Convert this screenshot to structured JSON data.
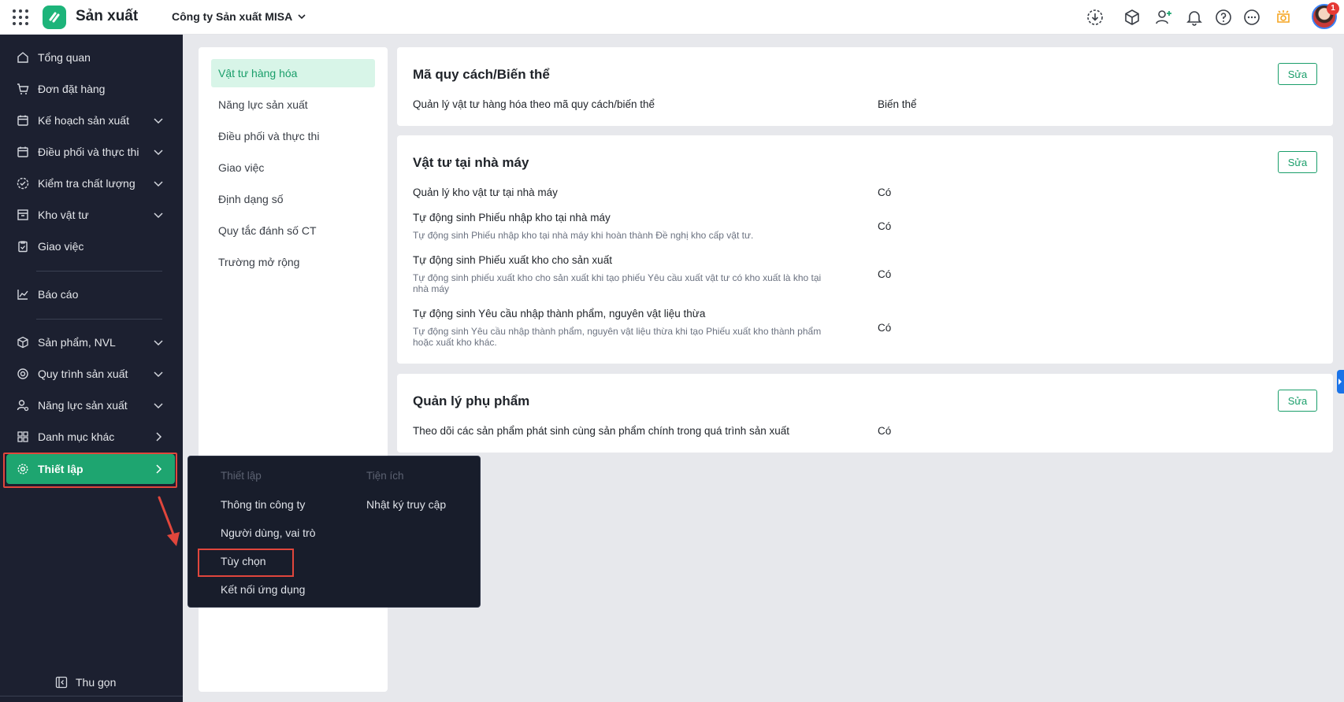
{
  "header": {
    "app_name": "Sản xuất",
    "company": "Công ty Sản xuất MISA",
    "notification_count": "1"
  },
  "sidebar": {
    "items": [
      {
        "label": "Tổng quan"
      },
      {
        "label": "Đơn đặt hàng"
      },
      {
        "label": "Kế hoạch sản xuất"
      },
      {
        "label": "Điều phối và thực thi"
      },
      {
        "label": "Kiểm tra chất lượng"
      },
      {
        "label": "Kho vật tư"
      },
      {
        "label": "Giao việc"
      },
      {
        "label": "Báo cáo"
      },
      {
        "label": "Sản phẩm, NVL"
      },
      {
        "label": "Quy trình sản xuất"
      },
      {
        "label": "Năng lực sản xuất"
      },
      {
        "label": "Danh mục khác"
      },
      {
        "label": "Thiết lập"
      }
    ],
    "collapse_label": "Thu gọn"
  },
  "settings_menu": {
    "items": [
      {
        "label": "Vật tư hàng hóa"
      },
      {
        "label": "Năng lực sản xuất"
      },
      {
        "label": "Điều phối và thực thi"
      },
      {
        "label": "Giao việc"
      },
      {
        "label": "Định dạng số"
      },
      {
        "label": "Quy tắc đánh số CT"
      },
      {
        "label": "Trường mở rộng"
      }
    ]
  },
  "cards": {
    "variant": {
      "title": "Mã quy cách/Biến thể",
      "edit_label": "Sửa",
      "rows": [
        {
          "label": "Quản lý vật tư hàng hóa theo mã quy cách/biến thể",
          "value": "Biến thể"
        }
      ]
    },
    "factory": {
      "title": "Vật tư tại nhà máy",
      "edit_label": "Sửa",
      "rows": [
        {
          "label": "Quản lý kho vật tư tại nhà máy",
          "desc": "",
          "value": "Có"
        },
        {
          "label": "Tự động sinh Phiếu nhập kho tại nhà máy",
          "desc": "Tự động sinh Phiếu nhập kho tại nhà máy khi hoàn thành Đề nghị kho cấp vật tư.",
          "value": "Có"
        },
        {
          "label": "Tự động sinh Phiếu xuất kho cho sản xuất",
          "desc": "Tự động sinh phiếu xuất kho cho sản xuất khi tạo phiếu Yêu cầu xuất vật tư có kho xuất là kho tại nhà máy",
          "value": "Có"
        },
        {
          "label": "Tự động sinh Yêu cầu nhập thành phẩm, nguyên vật liệu thừa",
          "desc": "Tự động sinh Yêu cầu nhập thành phẩm, nguyên vật liệu thừa khi tạo Phiếu xuất kho thành phẩm hoặc xuất kho khác.",
          "value": "Có"
        }
      ]
    },
    "byproduct": {
      "title": "Quản lý phụ phẩm",
      "edit_label": "Sửa",
      "rows": [
        {
          "label": "Theo dõi các sản phẩm phát sinh cùng sản phẩm chính trong quá trình sản xuất",
          "value": "Có"
        }
      ]
    }
  },
  "popup": {
    "col1_head": "Thiết lập",
    "col1_items": [
      {
        "label": "Thông tin công ty"
      },
      {
        "label": "Người dùng, vai trò"
      },
      {
        "label": "Tùy chọn"
      },
      {
        "label": "Kết nối ứng dụng"
      }
    ],
    "col2_head": "Tiện ích",
    "col2_items": [
      {
        "label": "Nhật ký truy cập"
      }
    ]
  },
  "colors": {
    "brand": "#1db47a",
    "sidebar_bg": "#1c2030",
    "active": "#1ea570",
    "highlight_box": "#e0463c"
  }
}
